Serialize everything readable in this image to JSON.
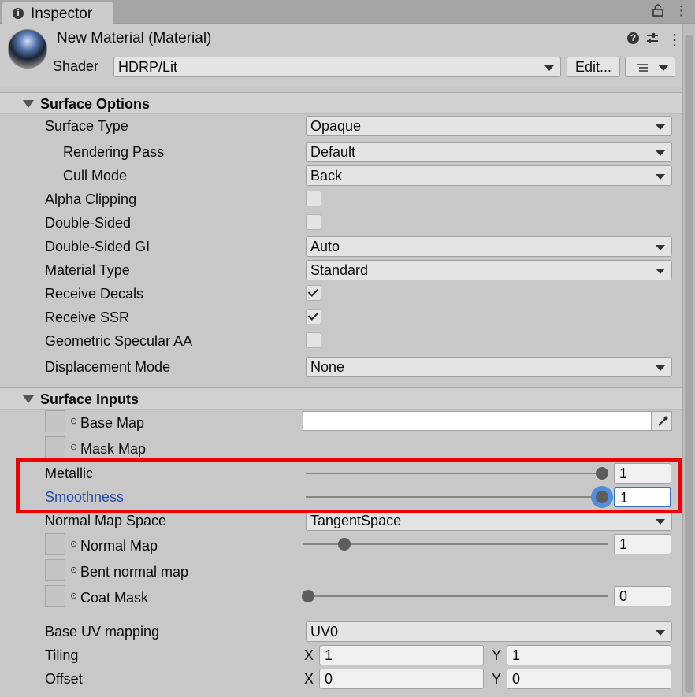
{
  "window": {
    "tab_label": "Inspector",
    "material_title": "New Material (Material)",
    "shader_label": "Shader",
    "shader_value": "HDRP/Lit",
    "edit_button": "Edit..."
  },
  "surface_options": {
    "title": "Surface Options",
    "surface_type": {
      "label": "Surface Type",
      "value": "Opaque"
    },
    "rendering_pass": {
      "label": "Rendering Pass",
      "value": "Default"
    },
    "cull_mode": {
      "label": "Cull Mode",
      "value": "Back"
    },
    "alpha_clipping": {
      "label": "Alpha Clipping",
      "checked": false
    },
    "double_sided": {
      "label": "Double-Sided",
      "checked": false
    },
    "double_sided_gi": {
      "label": "Double-Sided GI",
      "value": "Auto"
    },
    "material_type": {
      "label": "Material Type",
      "value": "Standard"
    },
    "receive_decals": {
      "label": "Receive Decals",
      "checked": true
    },
    "receive_ssr": {
      "label": "Receive SSR",
      "checked": true
    },
    "geometric_specular_aa": {
      "label": "Geometric Specular AA",
      "checked": false
    },
    "displacement_mode": {
      "label": "Displacement Mode",
      "value": "None"
    }
  },
  "surface_inputs": {
    "title": "Surface Inputs",
    "base_map": {
      "label": "Base Map",
      "color": "#ffffff"
    },
    "mask_map": {
      "label": "Mask Map"
    },
    "metallic": {
      "label": "Metallic",
      "value": "1",
      "fraction": 1.0
    },
    "smoothness": {
      "label": "Smoothness",
      "value": "1",
      "fraction": 1.0
    },
    "normal_map_space": {
      "label": "Normal Map Space",
      "value": "TangentSpace"
    },
    "normal_map": {
      "label": "Normal Map",
      "value": "1",
      "fraction": 0.13
    },
    "bent_normal_map": {
      "label": "Bent normal map"
    },
    "coat_mask": {
      "label": "Coat Mask",
      "value": "0",
      "fraction": 0.0
    },
    "base_uv_mapping": {
      "label": "Base UV mapping",
      "value": "UV0"
    },
    "tiling": {
      "label": "Tiling",
      "x_label": "X",
      "x": "1",
      "y_label": "Y",
      "y": "1"
    },
    "offset": {
      "label": "Offset",
      "x_label": "X",
      "x": "0",
      "y_label": "Y",
      "y": "0"
    }
  },
  "colors": {
    "highlight_box": "#ee0000",
    "smoothness_label": "#1f4fa5",
    "focus_ring": "#4f8fdb"
  }
}
